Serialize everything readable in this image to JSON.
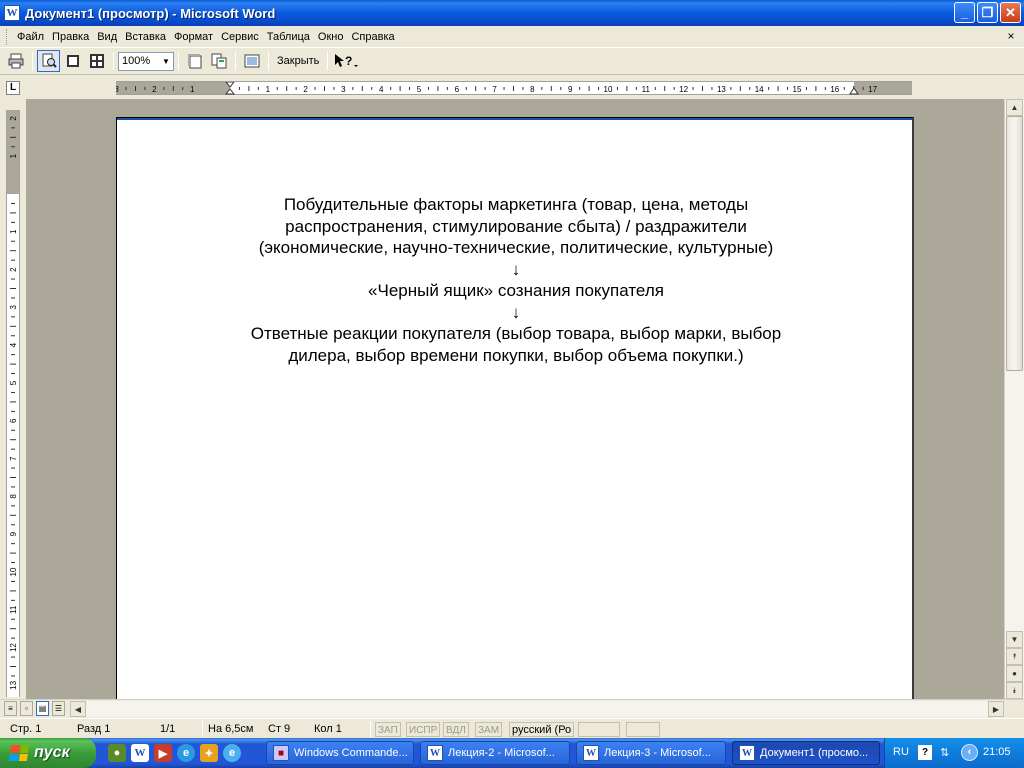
{
  "window": {
    "title": "Документ1 (просмотр) - Microsoft Word",
    "app_icon": "W",
    "buttons": {
      "minimize": "_",
      "restore": "❐",
      "close": "✕"
    }
  },
  "menubar": {
    "items": [
      {
        "label": "Файл"
      },
      {
        "label": "Правка"
      },
      {
        "label": "Вид"
      },
      {
        "label": "Вставка"
      },
      {
        "label": "Формат"
      },
      {
        "label": "Сервис"
      },
      {
        "label": "Таблица"
      },
      {
        "label": "Окно"
      },
      {
        "label": "Справка"
      }
    ],
    "close_glyph": "×"
  },
  "toolbar": {
    "zoom_value": "100%",
    "close_label": "Закрыть",
    "icons": [
      "print-icon",
      "magnifier-icon",
      "one-page-icon",
      "multiple-pages-icon",
      "shrink-to-fit-icon",
      "full-screen-icon",
      "context-help-icon"
    ]
  },
  "ruler": {
    "tab_selector": "L",
    "h_labels": [
      "3",
      "2",
      "1",
      "1",
      "2",
      "3",
      "4",
      "5",
      "6",
      "7",
      "8",
      "9",
      "10",
      "11",
      "12",
      "13",
      "14",
      "15",
      "16",
      "17"
    ],
    "v_labels": [
      "2",
      "1",
      "1",
      "2",
      "3",
      "4",
      "5",
      "6",
      "7",
      "8",
      "9",
      "10",
      "11",
      "12",
      "13"
    ]
  },
  "document": {
    "lines": [
      "Побудительные факторы маркетинга (товар, цена, методы",
      "распространения, стимулирование сбыта) / раздражители",
      "(экономические, научно-технические, политические, культурные)",
      "↓",
      "«Черный ящик» сознания покупателя",
      "↓",
      "Ответные реакции покупателя (выбор товара, выбор марки, выбор",
      "дилера, выбор времени покупки, выбор объема покупки.)"
    ]
  },
  "statusbar": {
    "page": "Стр. 1",
    "section": "Разд 1",
    "page_of": "1/1",
    "at": "На 6,5см",
    "line": "Ст 9",
    "col": "Кол 1",
    "rec": "ЗАП",
    "trk": "ИСПР",
    "ext": "ВДЛ",
    "ovr": "ЗАМ",
    "language": "русский (Ро"
  },
  "taskbar": {
    "start_label": "пуск",
    "tasks": [
      {
        "label": "Windows Commande...",
        "icon": "total-commander-icon"
      },
      {
        "label": "Лекция-2 - Microsof...",
        "icon": "word-icon"
      },
      {
        "label": "Лекция-3 - Microsof...",
        "icon": "word-icon"
      },
      {
        "label": "Документ1 (просмо...",
        "icon": "word-icon"
      }
    ],
    "tray": {
      "lang": "RU",
      "help": "?",
      "time": "21:05"
    }
  }
}
